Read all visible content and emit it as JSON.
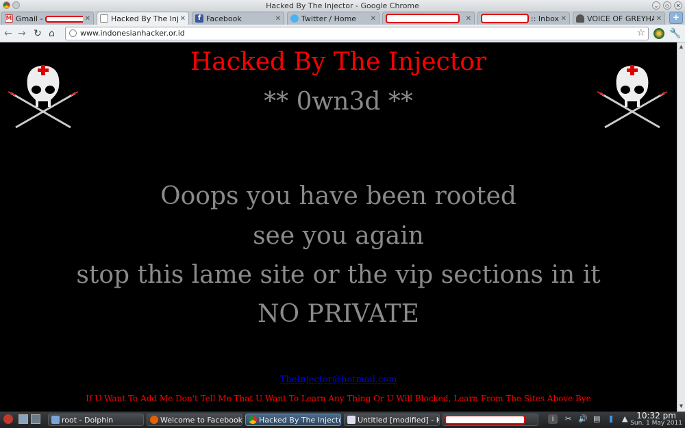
{
  "window": {
    "title": "Hacked By The Injector - Google Chrome"
  },
  "tabs": [
    {
      "label": "Gmail - ",
      "redacted": true,
      "icon": "gmail-icon"
    },
    {
      "label": "Hacked By The Inj...",
      "icon": "page-icon",
      "active": true
    },
    {
      "label": "Facebook",
      "icon": "facebook-icon"
    },
    {
      "label": "Twitter / Home",
      "icon": "twitter-icon"
    },
    {
      "label": "",
      "redacted": true,
      "icon": "page-icon"
    },
    {
      "label": ":: Inbox",
      "redacted": true,
      "icon": "page-icon"
    },
    {
      "label": "VOICE OF GREYHAT",
      "icon": "hat-icon"
    }
  ],
  "newtab_label": "+",
  "toolbar": {
    "url": "www.indonesianhacker.or.id"
  },
  "page": {
    "heading": "Hacked By The Injector",
    "subheading": "** 0wn3d **",
    "lines": [
      "Ooops you have been rooted",
      "see you again",
      "stop this lame site or the vip sections in it",
      "NO PRIVATE"
    ],
    "email": "TheInjector@hotmail.com",
    "footer": "If U Want To Add Me Don't Tell Me That U Want To Learn Any Thing Or U Will Blocked, Learn From The Sites Above Bye"
  },
  "colors": {
    "heading": "#ff0000",
    "body_text": "#8a8a8a",
    "link": "#0000ee",
    "footer": "#ff0000",
    "background": "#000000"
  },
  "taskbar": {
    "items": [
      {
        "label": "root - Dolphin",
        "icon": "folder-icon"
      },
      {
        "label": "Welcome to Facebook - L",
        "icon": "firefox-icon"
      },
      {
        "label": "Hacked By The Injector -",
        "icon": "chrome-icon",
        "active": true
      },
      {
        "label": "Untitled [modified] - KWr",
        "icon": "document-icon"
      },
      {
        "label": "",
        "redacted": true
      }
    ],
    "clock_time": "10:32 pm",
    "clock_date": "Sun, 1 May 2011"
  }
}
